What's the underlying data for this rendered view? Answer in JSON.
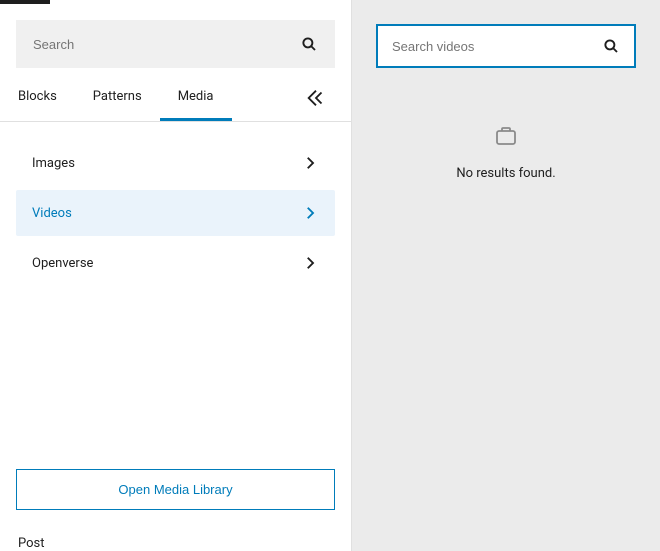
{
  "left": {
    "search": {
      "placeholder": "Search"
    },
    "tabs": {
      "blocks": "Blocks",
      "patterns": "Patterns",
      "media": "Media"
    },
    "media_items": {
      "images": "Images",
      "videos": "Videos",
      "openverse": "Openverse"
    },
    "open_library_label": "Open Media Library",
    "post_label": "Post"
  },
  "right": {
    "search": {
      "placeholder": "Search videos"
    },
    "empty_message": "No results found."
  }
}
